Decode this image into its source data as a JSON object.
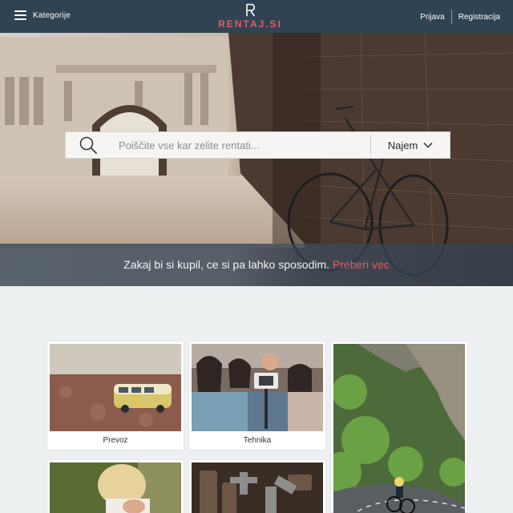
{
  "header": {
    "menu_label": "Kategorije",
    "logo_text": "RENTAJ.SI",
    "login": "Prijava",
    "register": "Registracija"
  },
  "search": {
    "placeholder": "Poiščite vse kar zelite rentati...",
    "value": "",
    "type_selected": "Najem"
  },
  "tagline": {
    "text": "Zakaj bi si kupil, ce si pa lahko sposodim.",
    "link": "Preberi vec"
  },
  "categories": [
    {
      "label": "Prevoz"
    },
    {
      "label": "Tehnika"
    },
    {
      "label": ""
    },
    {
      "label": ""
    },
    {
      "label": ""
    }
  ],
  "colors": {
    "header_bg": "#2f4353",
    "brand_red": "#e65a60",
    "page_bg": "#edf0f1"
  }
}
